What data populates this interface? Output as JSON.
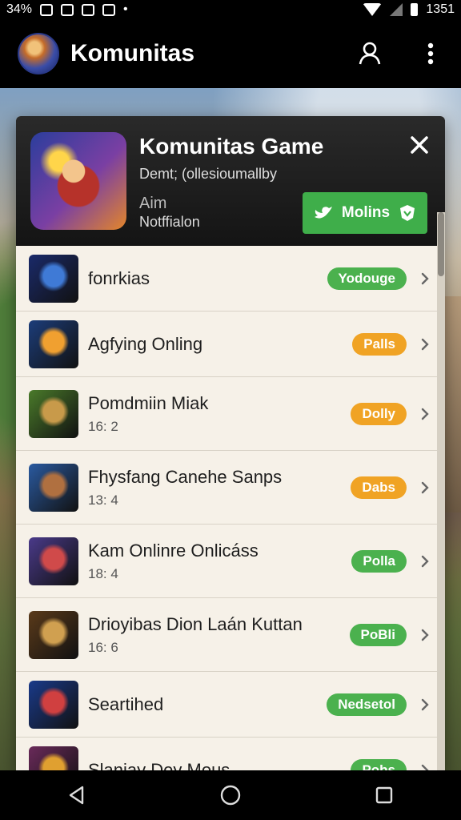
{
  "status_bar": {
    "left_text": "34%",
    "time": "1351"
  },
  "app_bar": {
    "title": "Komunitas",
    "icons": [
      "avatar",
      "profile-icon",
      "more-vert-icon"
    ]
  },
  "dialog": {
    "title": "Komunitas Game",
    "subtitle": "Demt; (ollesioumallby",
    "aim_label": "Aim",
    "notification_label": "Notffialon",
    "follow_button": "Molins",
    "colors": {
      "accent": "#3fae4a",
      "badge_orange": "#f0a324",
      "badge_green": "#4bb14e"
    }
  },
  "list": {
    "items": [
      {
        "title": "fonrkias",
        "meta": "",
        "badge": "Yodouge",
        "badge_color": "green",
        "thumb": [
          "#1a2a6a",
          "#3f7ad6"
        ]
      },
      {
        "title": "Agfying Onling",
        "meta": "",
        "badge": "Palls",
        "badge_color": "orange",
        "thumb": [
          "#1c3d7a",
          "#f0a030"
        ]
      },
      {
        "title": "Pomdmiin Miak",
        "meta": "16: 2",
        "badge": "Dolly",
        "badge_color": "orange",
        "thumb": [
          "#4a7a2a",
          "#c89a4a"
        ]
      },
      {
        "title": "Fhysfang Canehe Sanps",
        "meta": "13: 4",
        "badge": "Dabs",
        "badge_color": "orange",
        "thumb": [
          "#2a5aa0",
          "#b07040"
        ]
      },
      {
        "title": "Kam Onlinre Onlicáss",
        "meta": "18: 4",
        "badge": "Polla",
        "badge_color": "green",
        "thumb": [
          "#4a3a8a",
          "#d04a4a"
        ]
      },
      {
        "title": "Drioyibas Dion Laán Kuttan",
        "meta": "16: 6",
        "badge": "PoBli",
        "badge_color": "green",
        "thumb": [
          "#5a3a1a",
          "#d0a050"
        ]
      },
      {
        "title": "Seartihed",
        "meta": "",
        "badge": "Nedsetol",
        "badge_color": "green",
        "thumb": [
          "#1a3a8a",
          "#d04040"
        ]
      },
      {
        "title": "Slaniay Dey Mous",
        "meta": "",
        "badge": "Pobs",
        "badge_color": "green",
        "thumb": [
          "#6a2a5a",
          "#e0a030"
        ]
      }
    ]
  }
}
